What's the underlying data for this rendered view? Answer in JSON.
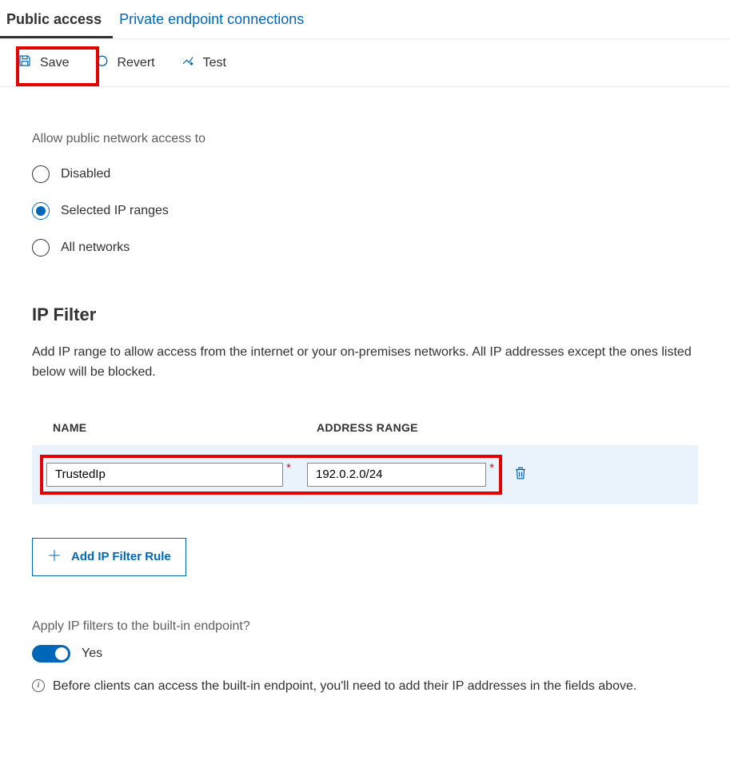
{
  "tabs": {
    "public": "Public access",
    "private": "Private endpoint connections"
  },
  "toolbar": {
    "save": "Save",
    "revert": "Revert",
    "test": "Test"
  },
  "access": {
    "label": "Allow public network access to",
    "options": {
      "disabled": "Disabled",
      "selected": "Selected IP ranges",
      "all": "All networks"
    },
    "value": "selected"
  },
  "ipfilter": {
    "heading": "IP Filter",
    "description": "Add IP range to allow access from the internet or your on-premises networks. All IP addresses except the ones listed below will be blocked.",
    "columns": {
      "name": "NAME",
      "range": "ADDRESS RANGE"
    },
    "rows": [
      {
        "name": "TrustedIp",
        "range": "192.0.2.0/24"
      }
    ],
    "add_button": "Add IP Filter Rule"
  },
  "applyFilter": {
    "label": "Apply IP filters to the built-in endpoint?",
    "value": true,
    "value_text": "Yes",
    "info": "Before clients can access the built-in endpoint, you'll need to add their IP addresses in the fields above."
  }
}
